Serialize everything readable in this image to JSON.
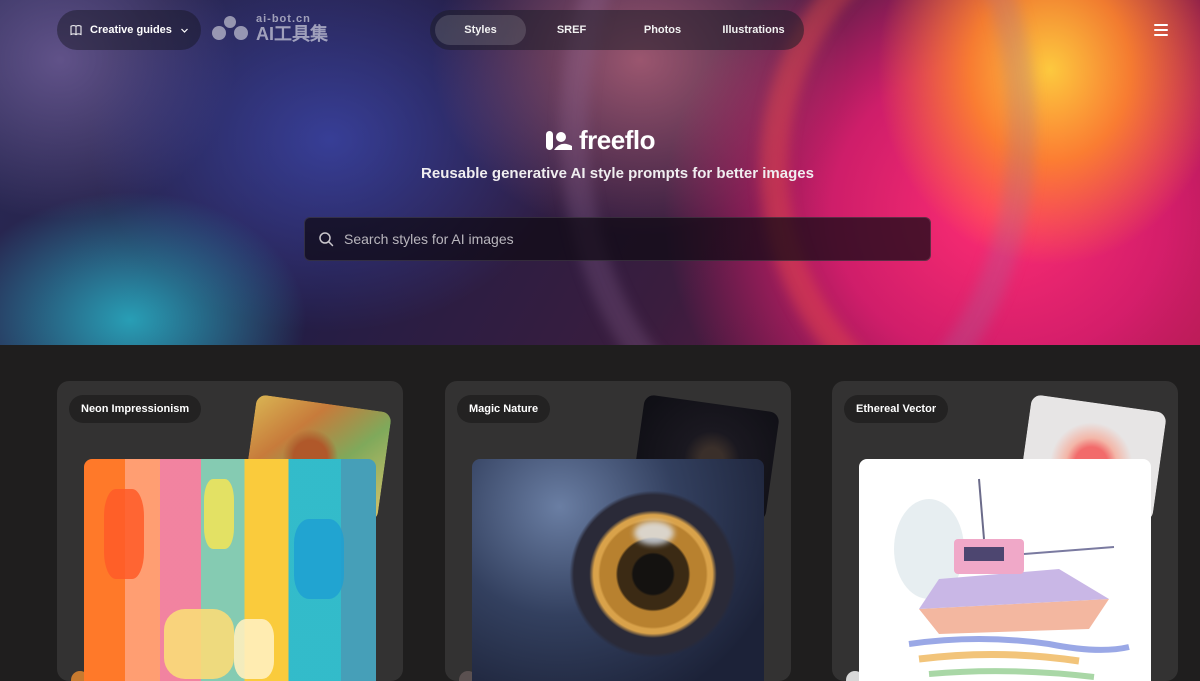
{
  "header": {
    "guides_label": "Creative guides",
    "watermark_small": "ai-bot.cn",
    "watermark_big": "AI工具集",
    "nav_tabs": [
      {
        "label": "Styles",
        "active": true
      },
      {
        "label": "SREF",
        "active": false
      },
      {
        "label": "Photos",
        "active": false
      },
      {
        "label": "Illustrations",
        "active": false
      }
    ]
  },
  "hero": {
    "brand_name": "freeflo",
    "tagline": "Reusable generative AI style prompts for better images",
    "search": {
      "placeholder": "Search styles for AI images",
      "value": ""
    }
  },
  "cards": [
    {
      "label": "Neon Impressionism"
    },
    {
      "label": "Magic Nature"
    },
    {
      "label": "Ethereal Vector"
    }
  ],
  "colors": {
    "page_background": "#1f1e1e",
    "card_background": "#333232",
    "hero_accent_pink": "#ff2d73",
    "hero_accent_orange": "#ffb03c"
  },
  "icons": {
    "guides": "book-icon",
    "dropdown": "chevron-down-icon",
    "menu": "hamburger-menu-icon",
    "search": "search-icon",
    "brand": "freeflo-logo-icon"
  }
}
